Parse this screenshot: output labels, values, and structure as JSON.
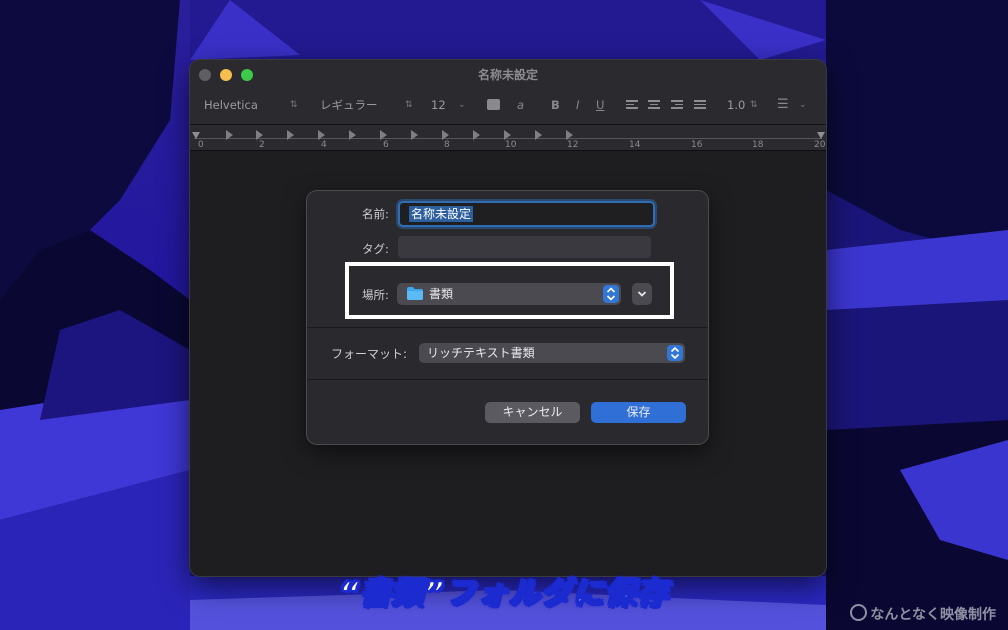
{
  "window": {
    "title": "名称未設定"
  },
  "toolbar": {
    "font_family": "Helvetica",
    "font_style": "レギュラー",
    "font_size": "12",
    "bold": "B",
    "italic": "I",
    "underline": "U",
    "text_color_glyph": "a",
    "line_spacing": "1.0"
  },
  "ruler": {
    "labels": [
      "0",
      "2",
      "4",
      "6",
      "8",
      "10",
      "12",
      "14",
      "16",
      "18",
      "20"
    ]
  },
  "save_sheet": {
    "name_label": "名前:",
    "name_value": "名称未設定",
    "tags_label": "タグ:",
    "where_label": "場所:",
    "where_value": "書類",
    "format_label": "フォーマット:",
    "format_value": "リッチテキスト書類",
    "cancel_label": "キャンセル",
    "save_label": "保存"
  },
  "caption": "“書類”フォルダに保存",
  "watermark": "なんとなく映像制作",
  "colors": {
    "accent": "#2f6fd6",
    "highlight_box": "#ffffff",
    "caption_stroke": "#1b2bd0"
  }
}
